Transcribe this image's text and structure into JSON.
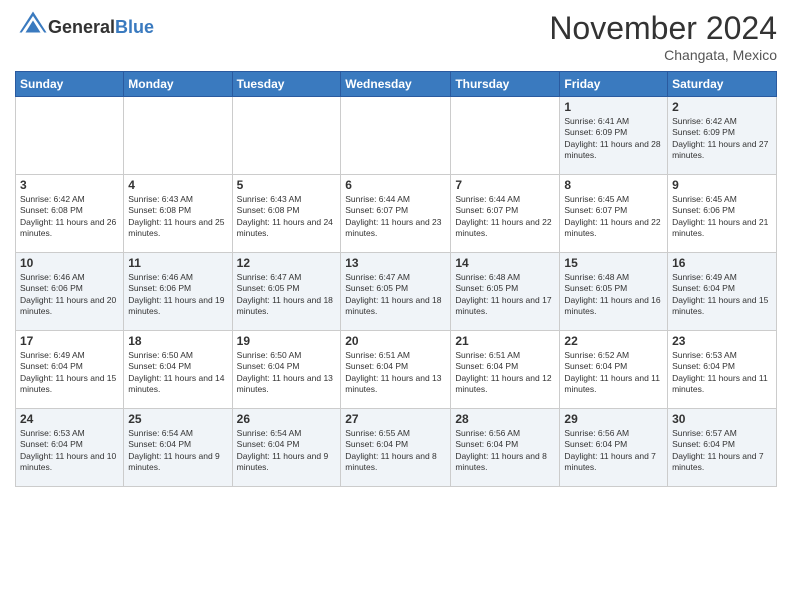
{
  "logo": {
    "general": "General",
    "blue": "Blue"
  },
  "header": {
    "month": "November 2024",
    "location": "Changata, Mexico"
  },
  "days_of_week": [
    "Sunday",
    "Monday",
    "Tuesday",
    "Wednesday",
    "Thursday",
    "Friday",
    "Saturday"
  ],
  "weeks": [
    [
      {
        "day": "",
        "info": ""
      },
      {
        "day": "",
        "info": ""
      },
      {
        "day": "",
        "info": ""
      },
      {
        "day": "",
        "info": ""
      },
      {
        "day": "",
        "info": ""
      },
      {
        "day": "1",
        "info": "Sunrise: 6:41 AM\nSunset: 6:09 PM\nDaylight: 11 hours and 28 minutes."
      },
      {
        "day": "2",
        "info": "Sunrise: 6:42 AM\nSunset: 6:09 PM\nDaylight: 11 hours and 27 minutes."
      }
    ],
    [
      {
        "day": "3",
        "info": "Sunrise: 6:42 AM\nSunset: 6:08 PM\nDaylight: 11 hours and 26 minutes."
      },
      {
        "day": "4",
        "info": "Sunrise: 6:43 AM\nSunset: 6:08 PM\nDaylight: 11 hours and 25 minutes."
      },
      {
        "day": "5",
        "info": "Sunrise: 6:43 AM\nSunset: 6:08 PM\nDaylight: 11 hours and 24 minutes."
      },
      {
        "day": "6",
        "info": "Sunrise: 6:44 AM\nSunset: 6:07 PM\nDaylight: 11 hours and 23 minutes."
      },
      {
        "day": "7",
        "info": "Sunrise: 6:44 AM\nSunset: 6:07 PM\nDaylight: 11 hours and 22 minutes."
      },
      {
        "day": "8",
        "info": "Sunrise: 6:45 AM\nSunset: 6:07 PM\nDaylight: 11 hours and 22 minutes."
      },
      {
        "day": "9",
        "info": "Sunrise: 6:45 AM\nSunset: 6:06 PM\nDaylight: 11 hours and 21 minutes."
      }
    ],
    [
      {
        "day": "10",
        "info": "Sunrise: 6:46 AM\nSunset: 6:06 PM\nDaylight: 11 hours and 20 minutes."
      },
      {
        "day": "11",
        "info": "Sunrise: 6:46 AM\nSunset: 6:06 PM\nDaylight: 11 hours and 19 minutes."
      },
      {
        "day": "12",
        "info": "Sunrise: 6:47 AM\nSunset: 6:05 PM\nDaylight: 11 hours and 18 minutes."
      },
      {
        "day": "13",
        "info": "Sunrise: 6:47 AM\nSunset: 6:05 PM\nDaylight: 11 hours and 18 minutes."
      },
      {
        "day": "14",
        "info": "Sunrise: 6:48 AM\nSunset: 6:05 PM\nDaylight: 11 hours and 17 minutes."
      },
      {
        "day": "15",
        "info": "Sunrise: 6:48 AM\nSunset: 6:05 PM\nDaylight: 11 hours and 16 minutes."
      },
      {
        "day": "16",
        "info": "Sunrise: 6:49 AM\nSunset: 6:04 PM\nDaylight: 11 hours and 15 minutes."
      }
    ],
    [
      {
        "day": "17",
        "info": "Sunrise: 6:49 AM\nSunset: 6:04 PM\nDaylight: 11 hours and 15 minutes."
      },
      {
        "day": "18",
        "info": "Sunrise: 6:50 AM\nSunset: 6:04 PM\nDaylight: 11 hours and 14 minutes."
      },
      {
        "day": "19",
        "info": "Sunrise: 6:50 AM\nSunset: 6:04 PM\nDaylight: 11 hours and 13 minutes."
      },
      {
        "day": "20",
        "info": "Sunrise: 6:51 AM\nSunset: 6:04 PM\nDaylight: 11 hours and 13 minutes."
      },
      {
        "day": "21",
        "info": "Sunrise: 6:51 AM\nSunset: 6:04 PM\nDaylight: 11 hours and 12 minutes."
      },
      {
        "day": "22",
        "info": "Sunrise: 6:52 AM\nSunset: 6:04 PM\nDaylight: 11 hours and 11 minutes."
      },
      {
        "day": "23",
        "info": "Sunrise: 6:53 AM\nSunset: 6:04 PM\nDaylight: 11 hours and 11 minutes."
      }
    ],
    [
      {
        "day": "24",
        "info": "Sunrise: 6:53 AM\nSunset: 6:04 PM\nDaylight: 11 hours and 10 minutes."
      },
      {
        "day": "25",
        "info": "Sunrise: 6:54 AM\nSunset: 6:04 PM\nDaylight: 11 hours and 9 minutes."
      },
      {
        "day": "26",
        "info": "Sunrise: 6:54 AM\nSunset: 6:04 PM\nDaylight: 11 hours and 9 minutes."
      },
      {
        "day": "27",
        "info": "Sunrise: 6:55 AM\nSunset: 6:04 PM\nDaylight: 11 hours and 8 minutes."
      },
      {
        "day": "28",
        "info": "Sunrise: 6:56 AM\nSunset: 6:04 PM\nDaylight: 11 hours and 8 minutes."
      },
      {
        "day": "29",
        "info": "Sunrise: 6:56 AM\nSunset: 6:04 PM\nDaylight: 11 hours and 7 minutes."
      },
      {
        "day": "30",
        "info": "Sunrise: 6:57 AM\nSunset: 6:04 PM\nDaylight: 11 hours and 7 minutes."
      }
    ]
  ]
}
